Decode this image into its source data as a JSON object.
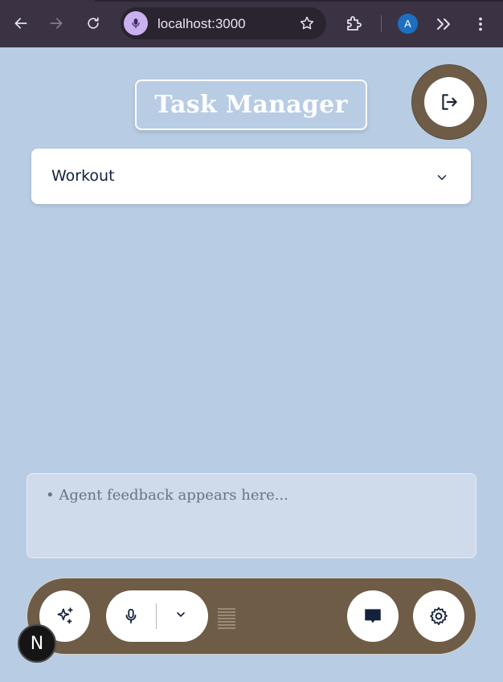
{
  "browser": {
    "url": "localhost:3000",
    "profile_initial": "A",
    "icons": [
      "back-icon",
      "forward-icon",
      "reload-icon",
      "microphone-icon",
      "star-icon",
      "extension-icon",
      "chevron-double-right-icon",
      "more-vertical-icon"
    ]
  },
  "app": {
    "title": "Task Manager",
    "select": {
      "value": "Workout"
    },
    "feedback": {
      "placeholder": "• Agent feedback appears here..."
    },
    "next_badge": "N",
    "colors": {
      "background": "#b8cce4",
      "accent_brown": "#6e5c47",
      "text_dark": "#14213d"
    },
    "toolbar_icons": [
      "sparkles-icon",
      "microphone-icon",
      "chevron-down-icon",
      "audio-level-icon",
      "chat-icon",
      "settings-icon"
    ]
  }
}
